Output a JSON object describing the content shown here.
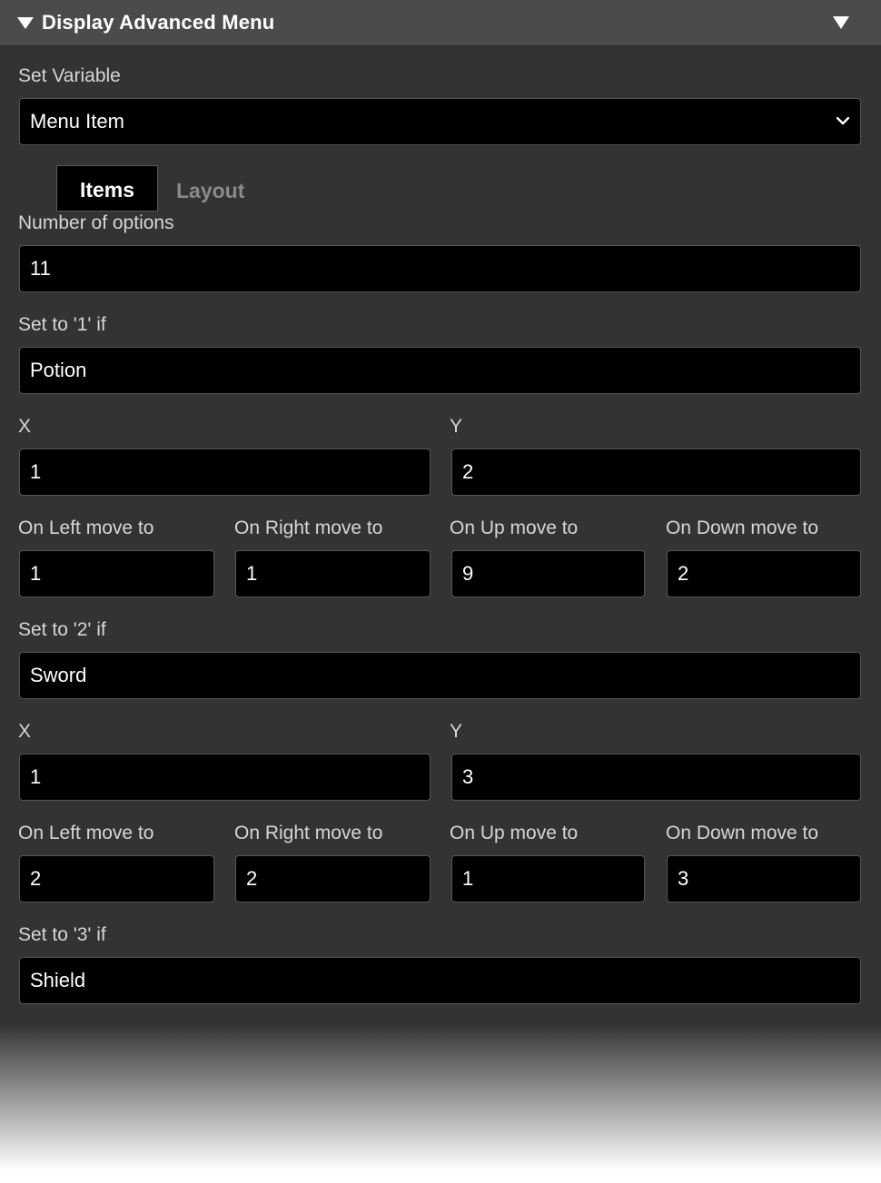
{
  "header": {
    "title": "Display Advanced Menu"
  },
  "set_variable": {
    "label": "Set Variable",
    "value": "Menu Item"
  },
  "tabs": [
    {
      "label": "Items"
    },
    {
      "label": "Layout"
    }
  ],
  "number_of_options": {
    "label": "Number of options",
    "value": "11"
  },
  "labels": {
    "x": "X",
    "y": "Y",
    "on_left": "On Left move to",
    "on_right": "On Right move to",
    "on_up": "On Up move to",
    "on_down": "On Down move to"
  },
  "options": [
    {
      "label": "Set to '1' if",
      "value": "Potion",
      "x": "1",
      "y": "2",
      "left": "1",
      "right": "1",
      "up": "9",
      "down": "2"
    },
    {
      "label": "Set to '2' if",
      "value": "Sword",
      "x": "1",
      "y": "3",
      "left": "2",
      "right": "2",
      "up": "1",
      "down": "3"
    },
    {
      "label": "Set to '3' if",
      "value": "Shield"
    }
  ]
}
